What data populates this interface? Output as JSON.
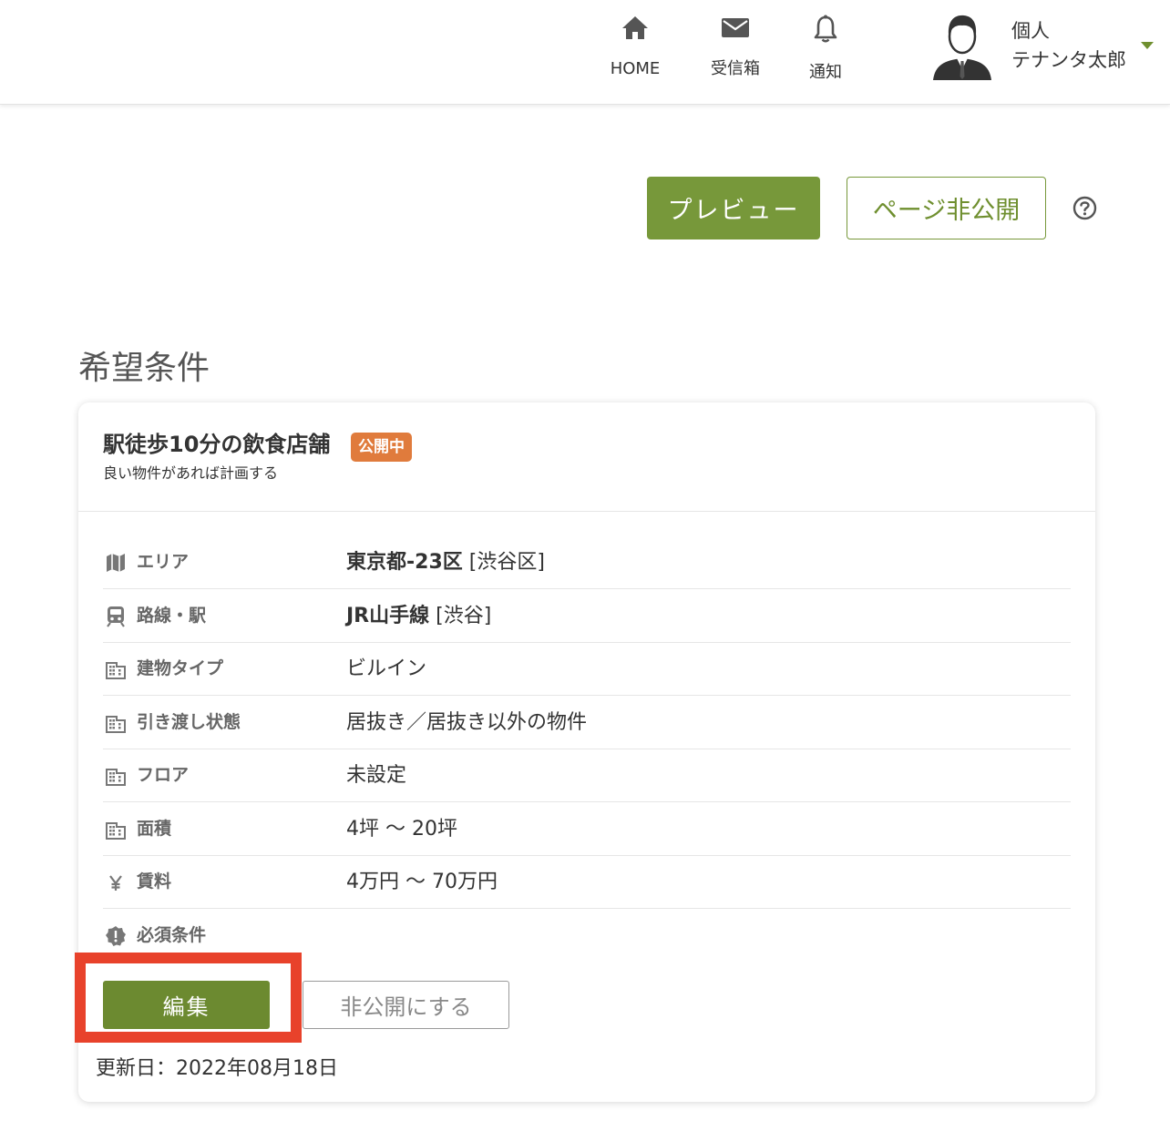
{
  "nav": {
    "home_label": "HOME",
    "inbox_label": "受信箱",
    "notice_label": "通知"
  },
  "user": {
    "type": "個人",
    "name": "テナンタ太郎"
  },
  "actions": {
    "preview_label": "プレビュー",
    "page_private_label": "ページ非公開"
  },
  "section_title": "希望条件",
  "card": {
    "title": "駅徒歩10分の飲食店舗",
    "badge": "公開中",
    "subtitle": "良い物件があれば計画する",
    "rows": [
      {
        "label": "エリア",
        "value_main": "東京都-23区",
        "value_sub": " [渋谷区]"
      },
      {
        "label": "路線・駅",
        "value_main": "JR山手線",
        "value_sub": " [渋谷]"
      },
      {
        "label": "建物タイプ",
        "value": "ビルイン"
      },
      {
        "label": "引き渡し状態",
        "value": "居抜き／居抜き以外の物件"
      },
      {
        "label": "フロア",
        "value": "未設定"
      },
      {
        "label": "面積",
        "value": "4坪 〜 20坪"
      },
      {
        "label": "賃料",
        "value": "4万円 〜 70万円"
      },
      {
        "label": "必須条件",
        "value": ""
      }
    ],
    "edit_label": "編集",
    "unpublish_label": "非公開にする",
    "updated": "更新日：2022年08月18日"
  },
  "colors": {
    "brand_green": "#77983a",
    "badge_orange": "#e07b3c",
    "highlight_red": "#e8422b"
  }
}
